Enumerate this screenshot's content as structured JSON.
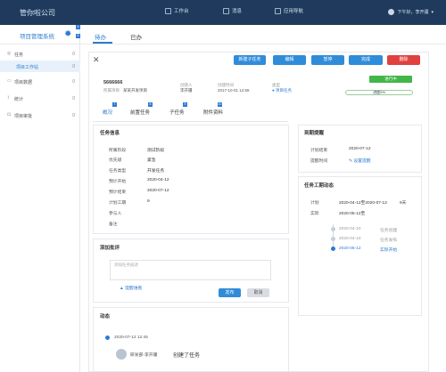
{
  "app": {
    "brand": "管你啦公司"
  },
  "topnav": [
    {
      "label": "工作台",
      "icon": "monitor-icon"
    },
    {
      "label": "消息",
      "icon": "bell-icon"
    },
    {
      "label": "应用导航",
      "icon": "grid-icon"
    }
  ],
  "user": {
    "greeting": "下午好，李开疆"
  },
  "sidebar": {
    "title": "项目管理系统",
    "items": [
      {
        "label": "任务",
        "count": "0",
        "icon": "task-icon"
      },
      {
        "label": "项目工作站",
        "count": "0"
      },
      {
        "label": "项目数据",
        "count": "0",
        "icon": "data-icon"
      },
      {
        "label": "统计",
        "count": "0",
        "icon": "chart-icon"
      },
      {
        "label": "项目审批",
        "count": "0",
        "icon": "approve-icon"
      }
    ]
  },
  "tabs": {
    "todo": "待办",
    "done": "已办"
  },
  "markers": {
    "m1": "5",
    "m2": "6",
    "m3": "7",
    "m4": "8",
    "m5": "9",
    "m6": "10"
  },
  "toolbar": {
    "new_subtask": "新建子任务",
    "edit": "编辑",
    "pause": "暂停",
    "complete": "完成",
    "delete": "删除"
  },
  "task": {
    "name": "5666666",
    "project_label": "所属项目",
    "project": "某某开发项目",
    "creator_label": "创建人",
    "creator": "李开疆",
    "created_label": "创建时间",
    "created": "2017-10-01  12:56",
    "type_label": "类型",
    "type": "● 项目任务",
    "status": "进行中",
    "progress_label": "进度0%",
    "progress": 0
  },
  "subtabs": [
    "概况",
    "前置任务",
    "子任务",
    "附件资料"
  ],
  "info": {
    "title": "任务信息",
    "fields": [
      {
        "k": "所属阶段",
        "v": "测试阶段"
      },
      {
        "k": "优先级",
        "v": "紧急"
      },
      {
        "k": "任务类型",
        "v": "开发任务"
      },
      {
        "k": "预计开始",
        "v": "2020-04-12"
      },
      {
        "k": "预计结束",
        "v": "2020-07-12"
      },
      {
        "k": "计划工期",
        "v": "9"
      },
      {
        "k": "参与人",
        "v": ""
      },
      {
        "k": "备注",
        "v": ""
      }
    ]
  },
  "reminder": {
    "title": "到期提醒",
    "plan_end_label": "计划结束",
    "plan_end": "2020-07-12",
    "remind_label": "提醒时间",
    "remind_action": "设置提醒"
  },
  "schedule": {
    "title": "任务工期动态",
    "plan_label": "计划",
    "plan": "2020-04-12至2020-07-12",
    "plan_days": "9天",
    "actual_label": "实际",
    "actual": "2020-05-12至",
    "timeline": [
      {
        "date": "2020-04-10",
        "event": "任务创建"
      },
      {
        "date": "2020-04-10",
        "event": "任务发布"
      },
      {
        "date": "2020-05-12",
        "event": "实际开始"
      }
    ]
  },
  "comment": {
    "title": "添加批评",
    "placeholder": "添加任务描述",
    "mention": "提醒谁看",
    "publish": "发布",
    "cancel": "取消"
  },
  "activity": {
    "title": "动态",
    "time": "2020-07-12   12:45",
    "author": "研发部-李开疆",
    "action": "创建了任务"
  }
}
